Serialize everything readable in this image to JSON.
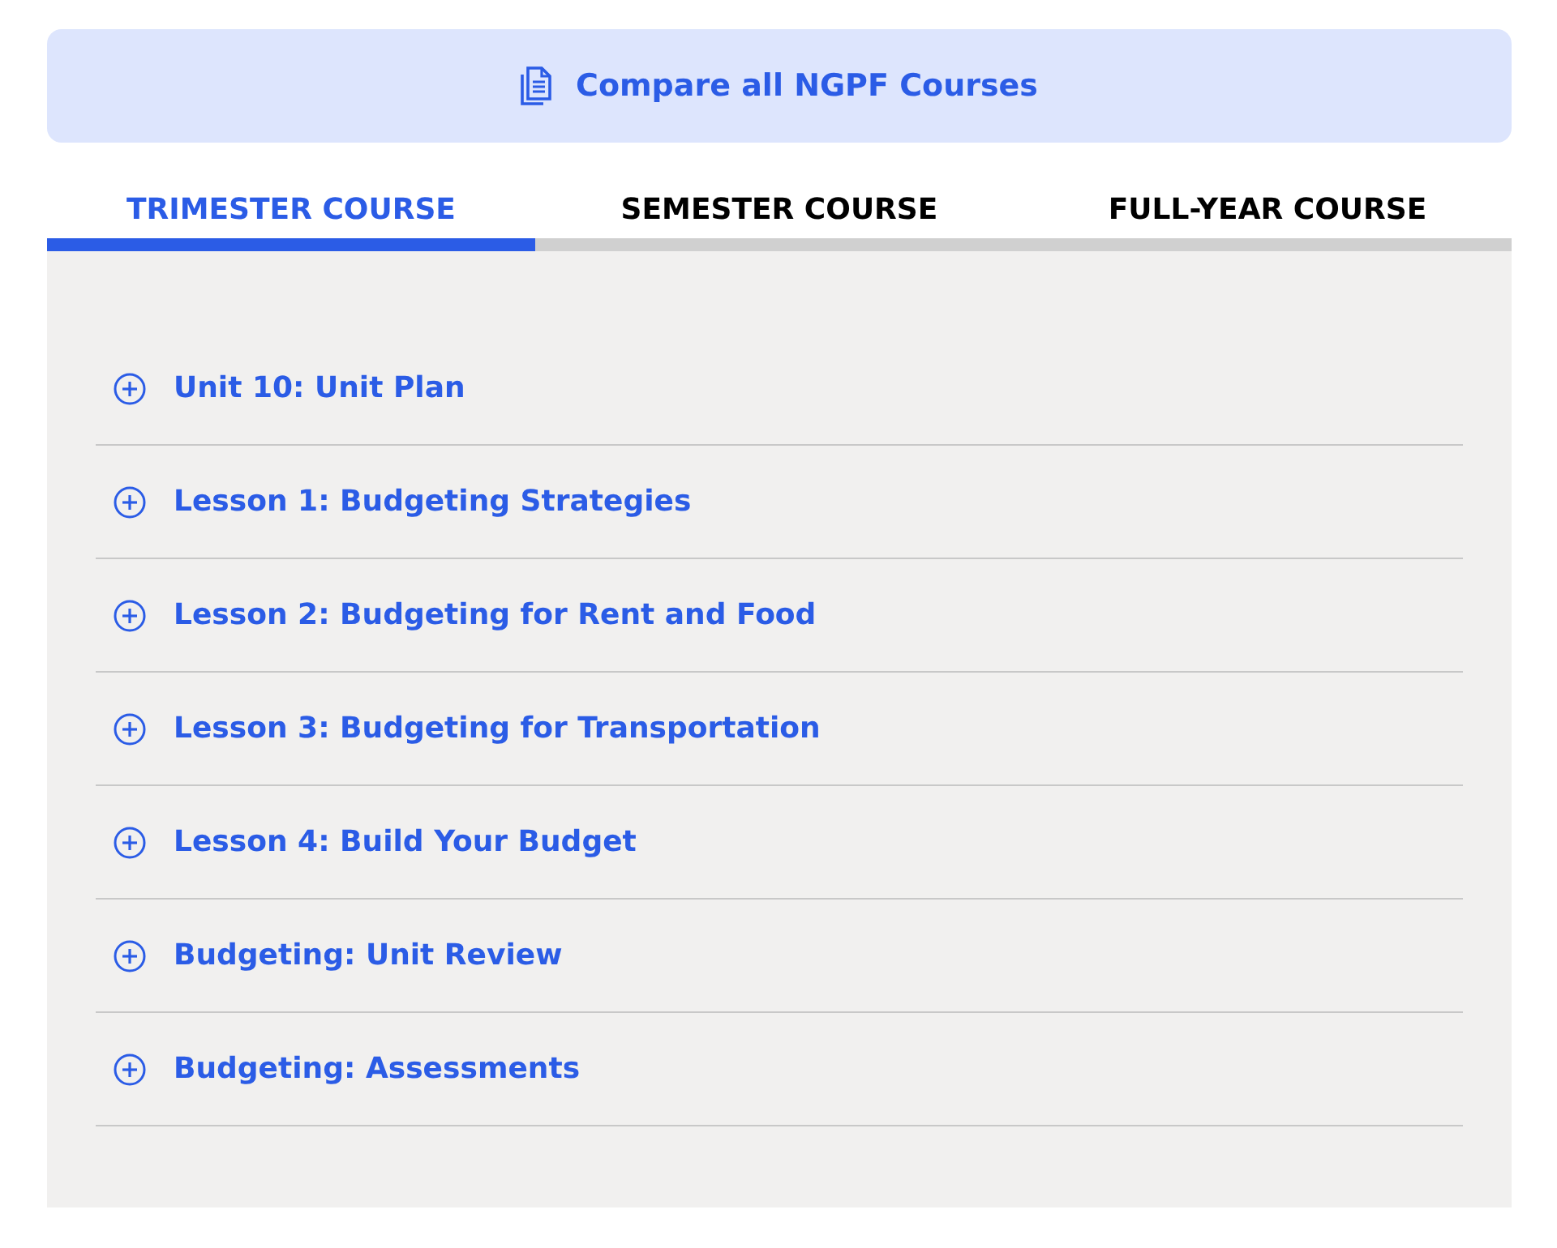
{
  "banner": {
    "label": "Compare all NGPF Courses"
  },
  "tabs": [
    {
      "label": "TRIMESTER COURSE",
      "selected": true
    },
    {
      "label": "SEMESTER COURSE",
      "selected": false
    },
    {
      "label": "FULL-YEAR COURSE",
      "selected": false
    }
  ],
  "accordion": {
    "items": [
      {
        "title": "Unit 10: Unit Plan",
        "expanded": false
      },
      {
        "title": "Lesson 1: Budgeting Strategies",
        "expanded": false
      },
      {
        "title": "Lesson 2: Budgeting for Rent and Food",
        "expanded": false
      },
      {
        "title": "Lesson 3: Budgeting for Transportation",
        "expanded": false
      },
      {
        "title": "Lesson 4: Build Your Budget",
        "expanded": false
      },
      {
        "title": "Budgeting: Unit Review",
        "expanded": false
      },
      {
        "title": "Budgeting: Assessments",
        "expanded": false
      }
    ]
  }
}
